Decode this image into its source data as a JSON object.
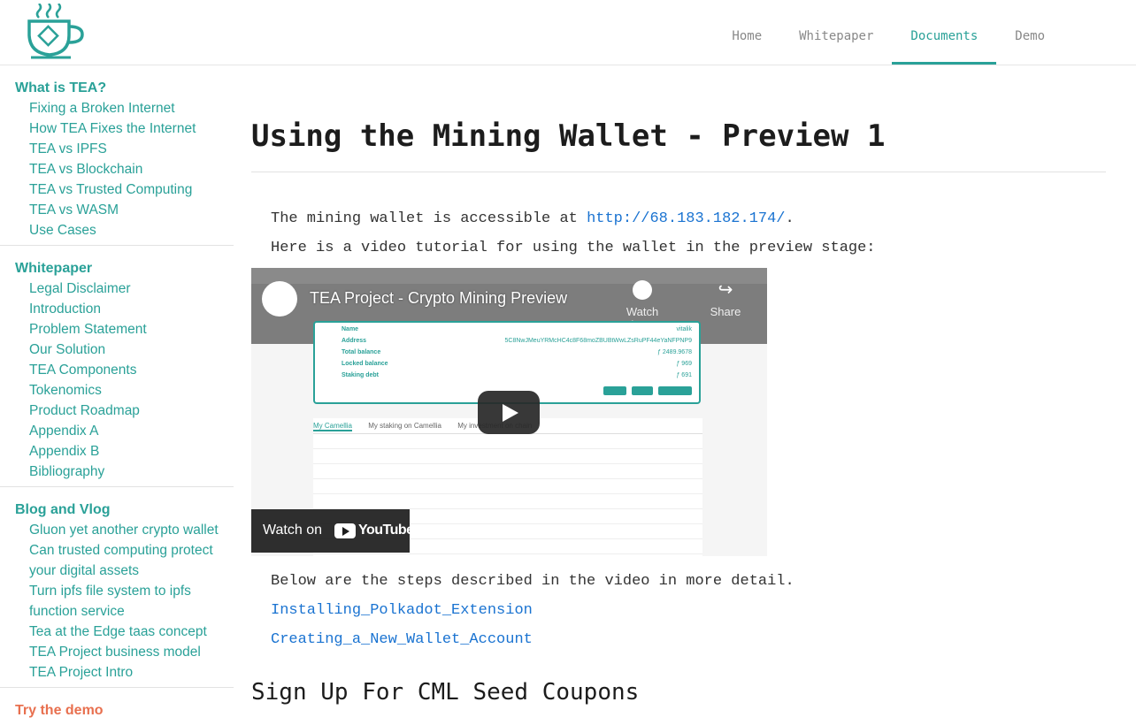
{
  "header": {
    "logo_name": "tea-cup-logo",
    "nav": [
      {
        "label": "Home",
        "active": false
      },
      {
        "label": "Whitepaper",
        "active": false
      },
      {
        "label": "Documents",
        "active": true
      },
      {
        "label": "Demo",
        "active": false
      }
    ]
  },
  "sidebar": {
    "sections": [
      {
        "title": "What is TEA?",
        "items": [
          "Fixing a Broken Internet",
          "How TEA Fixes the Internet",
          "TEA vs IPFS",
          "TEA vs Blockchain",
          "TEA vs Trusted Computing",
          "TEA vs WASM",
          "Use Cases"
        ]
      },
      {
        "title": "Whitepaper",
        "items": [
          "Legal Disclaimer",
          "Introduction",
          "Problem Statement",
          "Our Solution",
          "TEA Components",
          "Tokenomics",
          "Product Roadmap",
          "Appendix A",
          "Appendix B",
          "Bibliography"
        ]
      },
      {
        "title": "Blog and Vlog",
        "items": [
          "Gluon yet another crypto wallet",
          "Can trusted computing protect your digital assets",
          "Turn ipfs file system to ipfs function service",
          "Tea at the Edge taas concept",
          "TEA Project business model",
          "TEA Project Intro"
        ]
      },
      {
        "title": "Try the demo",
        "items": []
      }
    ]
  },
  "main": {
    "title": "Using the Mining Wallet - Preview 1",
    "p1_text": "The mining wallet is accessible at ",
    "p1_link": "http://68.183.182.174/",
    "p1_end": ".",
    "p2": "Here is a video tutorial for using the wallet in the preview stage:",
    "video": {
      "title": "TEA Project - Crypto Mining Preview",
      "watch_later": "Watch later",
      "share": "Share",
      "watch_on": "Watch on",
      "youtube": "YouTube",
      "card_rows": [
        {
          "label": "Name",
          "value": "vitalik"
        },
        {
          "label": "Address",
          "value": "5C8NwJMeuYRMcHC4c8F68moZBUBtWwLZsRuPF44eYaNFPNP9"
        },
        {
          "label": "Total balance",
          "value": "ƒ 2489.9678"
        },
        {
          "label": "Locked balance",
          "value": "ƒ 969"
        },
        {
          "label": "Staking debt",
          "value": "ƒ 691"
        }
      ],
      "tabs": [
        "My Camellia",
        "My staking on Camellia",
        "My investment on chain"
      ]
    },
    "p3": "Below are the steps described in the video in more detail.",
    "links": [
      "Installing_Polkadot_Extension",
      "Creating_a_New_Wallet_Account"
    ],
    "h2": "Sign Up For CML Seed Coupons"
  },
  "colors": {
    "accent": "#2aa198",
    "demo": "#e8704f",
    "link": "#1a73d1"
  }
}
